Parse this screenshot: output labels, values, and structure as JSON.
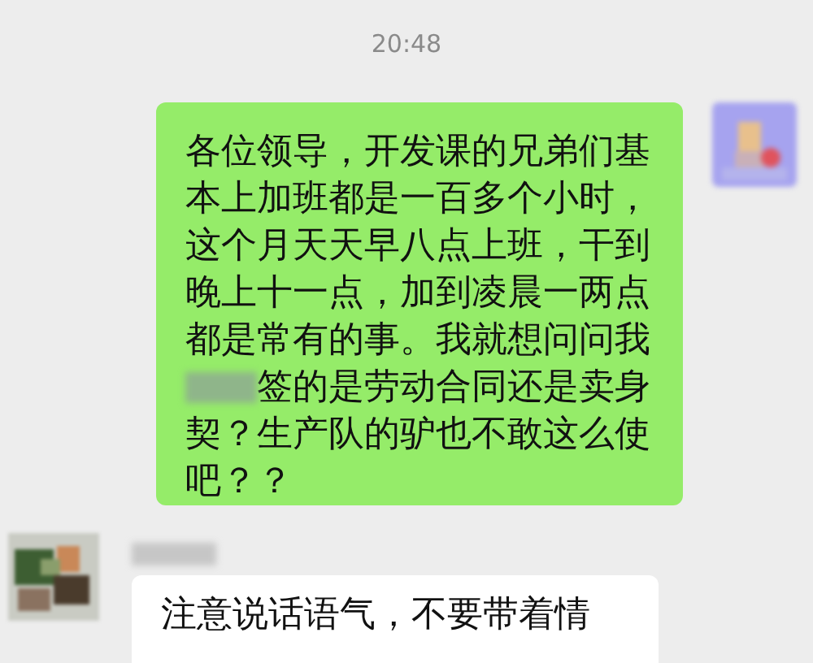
{
  "timestamp": "20:48",
  "messages": [
    {
      "kind": "sent",
      "segments": [
        {
          "kind": "text",
          "text": "各位领导，开发课的兄弟们基本上加班都是一百多个小时，这个月天天早八点上班，干到晚上十一点，加到凌晨一两点都是常有的事。我就想问问我"
        },
        {
          "kind": "redacted_line",
          "text": "签的是劳动合同还是卖身"
        },
        {
          "kind": "text",
          "text": "契？生产队的驴也不敢这么使吧？？"
        }
      ]
    },
    {
      "kind": "received",
      "segments": [
        {
          "kind": "text",
          "text": "注意说话语气，不要带着情"
        }
      ]
    }
  ]
}
